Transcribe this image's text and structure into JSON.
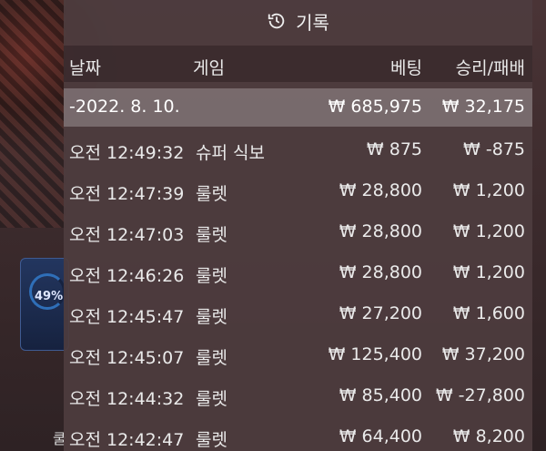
{
  "title": "기록",
  "side_badge": {
    "percent": "49%",
    "glyph": "쿨"
  },
  "columns": {
    "date": "날짜",
    "game": "게임",
    "bet": "베팅",
    "winloss": "승리/패배"
  },
  "day_summary": {
    "date": "-2022. 8. 10.",
    "bet": "₩ 685,975",
    "winloss": "₩ 32,175"
  },
  "rows": [
    {
      "time": "오전 12:49:32",
      "game": "슈퍼 식보",
      "bet": "₩ 875",
      "winloss": "₩ -875"
    },
    {
      "time": "오전 12:47:39",
      "game": "룰렛",
      "bet": "₩ 28,800",
      "winloss": "₩ 1,200"
    },
    {
      "time": "오전 12:47:03",
      "game": "룰렛",
      "bet": "₩ 28,800",
      "winloss": "₩ 1,200"
    },
    {
      "time": "오전 12:46:26",
      "game": "룰렛",
      "bet": "₩ 28,800",
      "winloss": "₩ 1,200"
    },
    {
      "time": "오전 12:45:47",
      "game": "룰렛",
      "bet": "₩ 27,200",
      "winloss": "₩ 1,600"
    },
    {
      "time": "오전 12:45:07",
      "game": "룰렛",
      "bet": "₩ 125,400",
      "winloss": "₩ 37,200"
    },
    {
      "time": "오전 12:44:32",
      "game": "룰렛",
      "bet": "₩ 85,400",
      "winloss": "₩ -27,800"
    },
    {
      "time": "오전 12:42:47",
      "game": "룰렛",
      "bet": "₩ 64,400",
      "winloss": "₩ 8,200"
    }
  ]
}
